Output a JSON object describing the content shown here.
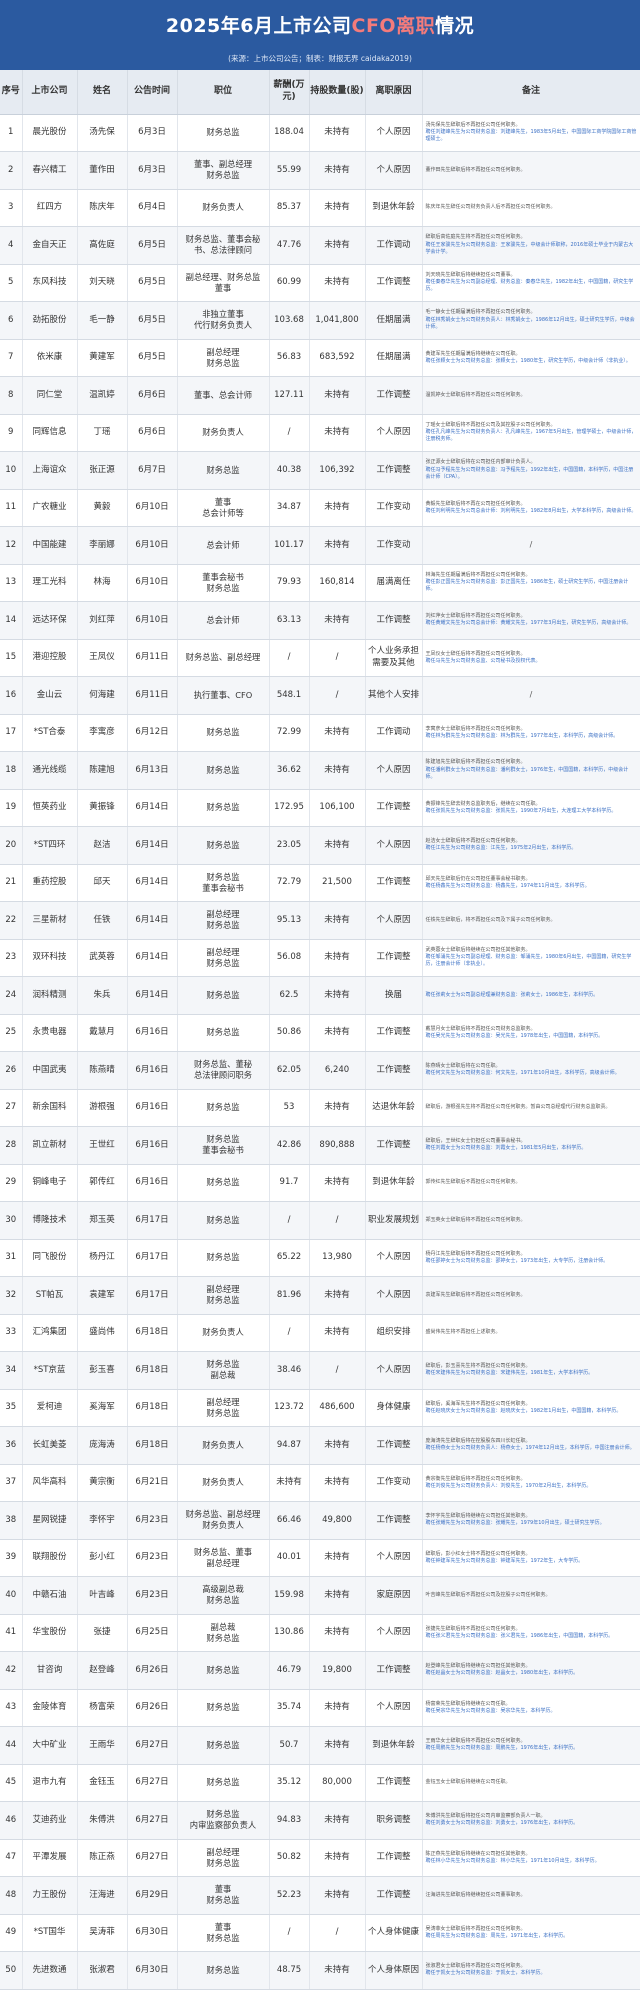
{
  "header": {
    "title_pre": "2025年6月上市公司",
    "title_hl": "CFO离职",
    "title_post": "情况",
    "source": "(来源：上市公司公告；制表：财报无界 caidaka2019)"
  },
  "columns": [
    "序号",
    "上市公司",
    "姓名",
    "公告时间",
    "职位",
    "薪酬(万元)",
    "持股数量(股)",
    "离职原因",
    "备注"
  ],
  "rows": [
    {
      "no": "1",
      "company": "晨光股份",
      "name": "汤先保",
      "date": "6月3日",
      "position": "财务总监",
      "salary": "188.04",
      "shares": "未持有",
      "reason": "个人原因",
      "note": "汤先保先生辞职后不再担任公司任何职务。",
      "note_hl": "聘任刘建峰先生为公司财务总监：刘建峰先生，1983年5月出生，中国国际工商学院国际工商管理硕士。"
    },
    {
      "no": "2",
      "company": "春兴精工",
      "name": "董作田",
      "date": "6月3日",
      "position": "董事、副总经理\n财务总监",
      "salary": "55.99",
      "shares": "未持有",
      "reason": "个人原因",
      "note": "董作田先生辞职后将不再担任公司任何职务。",
      "note_hl": ""
    },
    {
      "no": "3",
      "company": "红四方",
      "name": "陈庆年",
      "date": "6月4日",
      "position": "财务负责人",
      "salary": "85.37",
      "shares": "未持有",
      "reason": "到退休年龄",
      "note": "陈庆年先生辞任公司财务负责人后不再担任公司任何职务。",
      "note_hl": ""
    },
    {
      "no": "4",
      "company": "金自天正",
      "name": "高佐庭",
      "date": "6月5日",
      "position": "财务总监、董事会秘书、总法律顾问",
      "salary": "47.76",
      "shares": "未持有",
      "reason": "工作调动",
      "note": "辞职后高佐庭先生将不再担任公司任何职务。",
      "note_hl": "聘任王家骏先生为公司财务总监：王家骏先生，中级会计师职称，2016年硕士毕业于内蒙古大学会计学。"
    },
    {
      "no": "5",
      "company": "东风科技",
      "name": "刘天晓",
      "date": "6月5日",
      "position": "副总经理、财务总监\n董事",
      "salary": "60.99",
      "shares": "未持有",
      "reason": "工作调整",
      "note": "刘天晓先生辞职后将继续担任公司董事。",
      "note_hl": "聘任秦春华先生为公司副总经理、财务总监：秦春华先生，1982年出生，中国国籍，研究生学历。"
    },
    {
      "no": "6",
      "company": "劲拓股份",
      "name": "毛一静",
      "date": "6月5日",
      "position": "非独立董事\n代行财务负责人",
      "salary": "103.68",
      "shares": "1,041,800",
      "reason": "任期届满",
      "note": "毛一静女士任期届满后将不再担任公司任何职务。",
      "note_hl": "聘任林秀娟女士为公司财务负责人：林秀娟女士，1986年12月出生，硕士研究生学历，中级会计师。"
    },
    {
      "no": "7",
      "company": "依米康",
      "name": "黄建军",
      "date": "6月5日",
      "position": "副总经理\n财务总监",
      "salary": "56.83",
      "shares": "683,592",
      "reason": "任期届满",
      "note": "黄建军先生任期届满后将继续在公司任职。",
      "note_hl": "聘任张颖女士为公司财务总监：张颖女士，1980年生，研究生学历，中级会计师（非执业）。"
    },
    {
      "no": "8",
      "company": "同仁堂",
      "name": "温凯婷",
      "date": "6月6日",
      "position": "董事、总会计师",
      "salary": "127.11",
      "shares": "未持有",
      "reason": "工作调整",
      "note": "温凯婷女士辞职后将不再担任公司任何职务。",
      "note_hl": ""
    },
    {
      "no": "9",
      "company": "同辉信息",
      "name": "丁瑶",
      "date": "6月6日",
      "position": "财务负责人",
      "salary": "/",
      "shares": "未持有",
      "reason": "个人原因",
      "note": "丁瑶女士辞职后将不再担任公司及其控股子公司任何职务。",
      "note_hl": "聘任孔凡峰先生为公司财务负责人：孔凡峰先生，1967年5月出生，管理学硕士，中级会计师，注册税务师。"
    },
    {
      "no": "10",
      "company": "上海谊众",
      "name": "张正源",
      "date": "6月7日",
      "position": "财务总监",
      "salary": "40.38",
      "shares": "106,392",
      "reason": "工作调整",
      "note": "张正源女士辞职后将在公司担任内部审计负责人。",
      "note_hl": "聘任冯予程先生为公司财务总监：冯予程先生，1992年出生，中国国籍，本科学历，中国注册会计师（CPA）。"
    },
    {
      "no": "11",
      "company": "广农糖业",
      "name": "黄毅",
      "date": "6月10日",
      "position": "董事\n总会计师等",
      "salary": "34.87",
      "shares": "未持有",
      "reason": "工作变动",
      "note": "黄毅先生辞职后将不再在公司担任任何职务。",
      "note_hl": "聘任刘利明先生为公司总会计师：刘利明先生，1982年8月出生，大学本科学历，高级会计师。"
    },
    {
      "no": "12",
      "company": "中国能建",
      "name": "李丽娜",
      "date": "6月10日",
      "position": "总会计师",
      "salary": "101.17",
      "shares": "未持有",
      "reason": "工作变动",
      "note": "/",
      "note_hl": ""
    },
    {
      "no": "13",
      "company": "理工光科",
      "name": "林海",
      "date": "6月10日",
      "position": "董事会秘书\n财务总监",
      "salary": "79.93",
      "shares": "160,814",
      "reason": "届满离任",
      "note": "林海先生任期届满后将不再担任公司任何职务。",
      "note_hl": "聘任彭正国先生为公司财务总监：彭正国先生，1986年生，硕士研究生学历，中国注册会计师。"
    },
    {
      "no": "14",
      "company": "远达环保",
      "name": "刘红萍",
      "date": "6月10日",
      "position": "总会计师",
      "salary": "63.13",
      "shares": "未持有",
      "reason": "工作调整",
      "note": "刘红萍女士辞职后将不再担任公司任何职务。",
      "note_hl": "聘任黄耀文先生为公司总会计师：黄耀文先生，1977年3月出生，研究生学历，高级会计师。"
    },
    {
      "no": "15",
      "company": "港迎控股",
      "name": "王凤仪",
      "date": "6月11日",
      "position": "财务总监、副总经理",
      "salary": "/",
      "shares": "/",
      "reason": "个人业务承担需要及其他",
      "note": "王凤仪女士辞任后将不再担任公司任何职务。",
      "note_hl": "聘任马先生为公司财务总监、公司秘书及授权代表。"
    },
    {
      "no": "16",
      "company": "金山云",
      "name": "何海建",
      "date": "6月11日",
      "position": "执行董事、CFO",
      "salary": "548.1",
      "shares": "/",
      "reason": "其他个人安排",
      "note": "/",
      "note_hl": ""
    },
    {
      "no": "17",
      "company": "*ST合泰",
      "name": "李寓彦",
      "date": "6月12日",
      "position": "财务总监",
      "salary": "72.99",
      "shares": "未持有",
      "reason": "工作调动",
      "note": "李寓彦女士辞职后将不再担任公司任何职务。",
      "note_hl": "聘任林为群先生为公司财务总监：林为群先生，1977年出生，本科学历，高级会计师。"
    },
    {
      "no": "18",
      "company": "通光线缆",
      "name": "陈建旭",
      "date": "6月13日",
      "position": "财务总监",
      "salary": "36.62",
      "shares": "未持有",
      "reason": "个人原因",
      "note": "陈建旭先生辞职后将不再担任公司任何职务。",
      "note_hl": "聘任潘利群女士为公司财务总监：潘利群女士，1976年生，中国国籍，本科学历，中级会计师。"
    },
    {
      "no": "19",
      "company": "恒英药业",
      "name": "黄振锋",
      "date": "6月14日",
      "position": "财务总监",
      "salary": "172.95",
      "shares": "106,100",
      "reason": "工作调整",
      "note": "黄振锋先生辞去财务总监职务后，继续在公司任职。",
      "note_hl": "聘任张凯先生为公司财务总监：张凯先生，1990年7月出生，大连理工大学本科学历。"
    },
    {
      "no": "20",
      "company": "*ST四环",
      "name": "赵洁",
      "date": "6月14日",
      "position": "财务总监",
      "salary": "23.05",
      "shares": "未持有",
      "reason": "个人原因",
      "note": "赵洁女士辞职后将不再担任公司任何职务。",
      "note_hl": "聘任江先生为公司财务总监：江先生，1975年2月出生，本科学历。"
    },
    {
      "no": "21",
      "company": "重药控股",
      "name": "邱天",
      "date": "6月14日",
      "position": "财务总监\n董事会秘书",
      "salary": "72.79",
      "shares": "21,500",
      "reason": "工作调整",
      "note": "邱天先生辞职后仍在公司担任董事会秘书职务。",
      "note_hl": "聘任杨鑫先生为公司财务总监：杨鑫先生，1974年11月出生，本科学历。"
    },
    {
      "no": "22",
      "company": "三星新材",
      "name": "任铁",
      "date": "6月14日",
      "position": "副总经理\n财务总监",
      "salary": "95.13",
      "shares": "未持有",
      "reason": "个人原因",
      "note": "任铁先生辞职后，将不再担任公司及下属子公司任何职务。",
      "note_hl": ""
    },
    {
      "no": "23",
      "company": "双环科技",
      "name": "武英蓉",
      "date": "6月14日",
      "position": "副总经理\n财务总监",
      "salary": "56.08",
      "shares": "未持有",
      "reason": "工作调整",
      "note": "武英蓉女士辞职后将继续在公司担任其他职务。",
      "note_hl": "聘任邹涌先生为公司副总经理、财务总监：邹涌先生，1980年6月出生，中国国籍，研究生学历，注册会计师（非执业）。"
    },
    {
      "no": "24",
      "company": "润科精测",
      "name": "朱兵",
      "date": "6月14日",
      "position": "财务总监",
      "salary": "62.5",
      "shares": "未持有",
      "reason": "换届",
      "note": "",
      "note_hl": "聘任张莉女士为公司副总经理兼财务总监：张莉女士，1986年生，本科学历。"
    },
    {
      "no": "25",
      "company": "永贵电器",
      "name": "戴慧月",
      "date": "6月16日",
      "position": "财务总监",
      "salary": "50.86",
      "shares": "未持有",
      "reason": "工作调整",
      "note": "戴慧月女士辞职后将不再担任公司财务总监职务。",
      "note_hl": "聘任吴光先生为公司财务总监：吴光先生，1978年出生，中国国籍，本科学历。"
    },
    {
      "no": "26",
      "company": "中国武夷",
      "name": "陈燕晴",
      "date": "6月16日",
      "position": "财务总监、董秘\n总法律顾问职务",
      "salary": "62.05",
      "shares": "6,240",
      "reason": "工作调整",
      "note": "陈燕晴女士辞职后将在公司任职。",
      "note_hl": "聘任何文先生为公司财务总监：何文先生，1971年10月出生，本科学历，高级会计师。"
    },
    {
      "no": "27",
      "company": "新余国科",
      "name": "游根强",
      "date": "6月16日",
      "position": "财务总监",
      "salary": "53",
      "shares": "未持有",
      "reason": "达退休年龄",
      "note": "辞职后，游根强先生将不再担任公司任何职务。暂由公司总经理代行财务总监职责。",
      "note_hl": ""
    },
    {
      "no": "28",
      "company": "凯立新材",
      "name": "王世红",
      "date": "6月16日",
      "position": "财务总监\n董事会秘书",
      "salary": "42.86",
      "shares": "890,888",
      "reason": "工作调整",
      "note": "辞职后，王世红女士仍担任公司董事会秘书。",
      "note_hl": "聘任刘霞女士为公司财务总监：刘霞女士，1981年5月出生，本科学历。"
    },
    {
      "no": "29",
      "company": "铜峰电子",
      "name": "郭传红",
      "date": "6月16日",
      "position": "财务总监",
      "salary": "91.7",
      "shares": "未持有",
      "reason": "到退休年龄",
      "note": "郭传红先生辞职后不再担任公司任何职务。",
      "note_hl": ""
    },
    {
      "no": "30",
      "company": "博隆技术",
      "name": "郑玉英",
      "date": "6月17日",
      "position": "财务总监",
      "salary": "/",
      "shares": "/",
      "reason": "职业发展规划",
      "note": "郑玉英女士辞职后将不再担任公司任何职务。",
      "note_hl": ""
    },
    {
      "no": "31",
      "company": "同飞股份",
      "name": "杨丹江",
      "date": "6月17日",
      "position": "财务总监",
      "salary": "65.22",
      "shares": "13,980",
      "reason": "个人原因",
      "note": "杨丹江先生辞职后将不再担任公司任何职务。",
      "note_hl": "聘任邵婷女士为公司财务总监：邵婷女士，1973年出生，大专学历，注册会计师。"
    },
    {
      "no": "32",
      "company": "ST帕瓦",
      "name": "袁建军",
      "date": "6月17日",
      "position": "副总经理\n财务总监",
      "salary": "81.96",
      "shares": "未持有",
      "reason": "个人原因",
      "note": "袁建军先生辞职后将不再担任公司任何职务。",
      "note_hl": ""
    },
    {
      "no": "33",
      "company": "汇鸿集团",
      "name": "盛尚伟",
      "date": "6月18日",
      "position": "财务负责人",
      "salary": "/",
      "shares": "未持有",
      "reason": "组织安排",
      "note": "盛尚伟先生将不再担任上述职务。",
      "note_hl": ""
    },
    {
      "no": "34",
      "company": "*ST京蓝",
      "name": "彭玉喜",
      "date": "6月18日",
      "position": "财务总监\n副总裁",
      "salary": "38.46",
      "shares": "/",
      "reason": "个人原因",
      "note": "辞职后，彭玉喜先生将不再担任公司任何职务。",
      "note_hl": "聘任宋建伟先生为公司财务总监：宋建伟先生，1981年生，大学本科学历。"
    },
    {
      "no": "35",
      "company": "爱柯迪",
      "name": "奚海军",
      "date": "6月18日",
      "position": "副总经理\n财务总监",
      "salary": "123.72",
      "shares": "486,600",
      "reason": "身体健康",
      "note": "辞职后，奚海军先生将不再担任公司任何职务。",
      "note_hl": "聘任赵晓庆女士为公司财务总监：赵晓庆女士，1982年1月出生，中国国籍，本科学历。"
    },
    {
      "no": "36",
      "company": "长虹美菱",
      "name": "庞海涛",
      "date": "6月18日",
      "position": "财务负责人",
      "salary": "94.87",
      "shares": "未持有",
      "reason": "工作调整",
      "note": "庞海涛先生辞职后将在控股股东四川长虹任职。",
      "note_hl": "聘任杨燕女士为公司财务负责人：杨燕女士，1974年12月出生，本科学历，中国注册会计师。"
    },
    {
      "no": "37",
      "company": "风华高科",
      "name": "黄宗衡",
      "date": "6月21日",
      "position": "财务负责人",
      "salary": "未持有",
      "shares": "未持有",
      "reason": "工作变动",
      "note": "黄宗衡先生辞职后将不再担任公司任何职务。",
      "note_hl": "聘任刘俊先生为公司财务负责人：刘俊先生，1970年2月出生，本科学历。"
    },
    {
      "no": "38",
      "company": "星网锐捷",
      "name": "李怀宇",
      "date": "6月23日",
      "position": "财务总监、副总经理\n财务负责人",
      "salary": "66.46",
      "shares": "49,800",
      "reason": "工作调整",
      "note": "李怀宇先生辞职后将继续在公司担任其他职务。",
      "note_hl": "聘任张耀先生为公司财务总监：张耀先生，1979年10月出生，硕士研究生学历。"
    },
    {
      "no": "39",
      "company": "联翔股份",
      "name": "彭小红",
      "date": "6月23日",
      "position": "财务总监、董事\n副总经理",
      "salary": "40.01",
      "shares": "未持有",
      "reason": "个人原因",
      "note": "辞职后，彭小红女士将不再担任公司任何职务。",
      "note_hl": "聘任钟建军先生为公司财务总监：钟建军先生，1972年生，大专学历。"
    },
    {
      "no": "40",
      "company": "中赣石油",
      "name": "叶吉峰",
      "date": "6月23日",
      "position": "高级副总裁\n财务总监",
      "salary": "159.98",
      "shares": "未持有",
      "reason": "家庭原因",
      "note": "叶吉峰先生辞职后不再担任公司及控股子公司任何职务。",
      "note_hl": ""
    },
    {
      "no": "41",
      "company": "华宝股份",
      "name": "张捷",
      "date": "6月25日",
      "position": "副总裁\n财务总监",
      "salary": "130.86",
      "shares": "未持有",
      "reason": "个人原因",
      "note": "张捷先生辞职后将不再担任公司任何职务。",
      "note_hl": "聘任张义君先生为公司财务总监：张义君先生，1986年出生，中国国籍，本科学历。"
    },
    {
      "no": "42",
      "company": "甘咨询",
      "name": "赵登峰",
      "date": "6月26日",
      "position": "财务总监",
      "salary": "46.79",
      "shares": "19,800",
      "reason": "工作调整",
      "note": "赵登峰先生辞职后将继续在公司担任其他职务。",
      "note_hl": "聘任赵晶女士为公司财务总监：赵晶女士，1980年出生，本科学历。"
    },
    {
      "no": "43",
      "company": "金陵体育",
      "name": "杨富荣",
      "date": "6月26日",
      "position": "财务总监",
      "salary": "35.74",
      "shares": "未持有",
      "reason": "个人原因",
      "note": "杨富荣先生辞职后将继续在公司任职。",
      "note_hl": "聘任吴宗华先生为公司财务总监：吴宗华先生，本科学历。"
    },
    {
      "no": "44",
      "company": "大中矿业",
      "name": "王雨华",
      "date": "6月27日",
      "position": "财务总监",
      "salary": "50.7",
      "shares": "未持有",
      "reason": "到退休年龄",
      "note": "王雨华女士辞职后将不再担任公司任何职务。",
      "note_hl": "聘任周鹏先生为公司财务总监：周鹏先生，1976年出生，本科学历。"
    },
    {
      "no": "45",
      "company": "退市九有",
      "name": "金钰玉",
      "date": "6月27日",
      "position": "财务总监",
      "salary": "35.12",
      "shares": "80,000",
      "reason": "工作调整",
      "note": "金钰玉女士辞职后将继续在公司任职。",
      "note_hl": ""
    },
    {
      "no": "46",
      "company": "艾迪药业",
      "name": "朱傅洪",
      "date": "6月27日",
      "position": "财务总监\n内审监察部负责人",
      "salary": "94.83",
      "shares": "未持有",
      "reason": "职务调整",
      "note": "朱傅洪先生辞职后将担任公司内审监察部负责人一职。",
      "note_hl": "聘任刘勇女士为公司财务总监：刘勇女士，1976年出生，本科学历。"
    },
    {
      "no": "47",
      "company": "平潭发展",
      "name": "陈正燕",
      "date": "6月27日",
      "position": "副总经理\n财务总监",
      "salary": "50.82",
      "shares": "未持有",
      "reason": "工作调整",
      "note": "陈正燕先生辞职后将继续在公司担任其他职务。",
      "note_hl": "聘任林小华先生为公司财务总监：林小华先生，1971年10月出生，本科学历。"
    },
    {
      "no": "48",
      "company": "力王股份",
      "name": "汪海进",
      "date": "6月29日",
      "position": "董事\n财务总监",
      "salary": "52.23",
      "shares": "未持有",
      "reason": "工作调整",
      "note": "汪海进先生辞职后将继续担任公司董事职务。",
      "note_hl": ""
    },
    {
      "no": "49",
      "company": "*ST国华",
      "name": "吴涛菲",
      "date": "6月30日",
      "position": "董事\n财务总监",
      "salary": "/",
      "shares": "/",
      "reason": "个人身体健康",
      "note": "吴涛菲女士辞职后将不再担任公司任何职务。",
      "note_hl": "聘任周先生为公司财务总监：周先生，1971年出生，本科学历。"
    },
    {
      "no": "50",
      "company": "先进数通",
      "name": "张淑君",
      "date": "6月30日",
      "position": "财务总监",
      "salary": "48.75",
      "shares": "未持有",
      "reason": "个人身体原因",
      "note": "张淑君女士辞职后将不再担任公司任何职务。",
      "note_hl": "聘任于凯女士为公司财务总监：于凯女士，本科学历。"
    }
  ]
}
